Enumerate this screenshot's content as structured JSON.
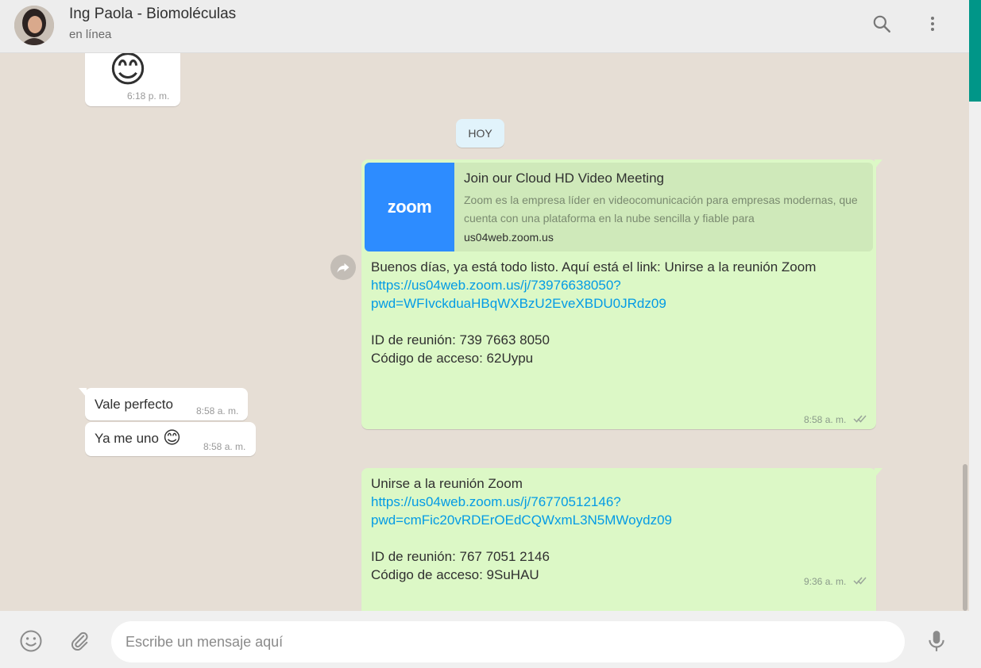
{
  "header": {
    "contact_name": "Ing Paola - Biomoléculas",
    "status": "en línea",
    "avatar_icon": "contact-avatar",
    "search_icon": "search-icon",
    "menu_icon": "more-vert-icon"
  },
  "chat": {
    "messages": [
      {
        "direction": "incoming",
        "content": "😊",
        "time": "6:18 p. m."
      },
      {
        "type": "date-divider",
        "label": "HOY"
      },
      {
        "direction": "outgoing",
        "link_preview": {
          "logo_text": "zoom",
          "title": "Join our Cloud HD Video Meeting",
          "description": "Zoom es la empresa líder en videocomunicación para empresas modernas, que cuenta con una plataforma en la nube sencilla y fiable para",
          "domain": "us04web.zoom.us"
        },
        "text_line1": "Buenos días, ya está todo listo. Aquí está el link: Unirse a la reunión Zoom",
        "link_line1": "https://us04web.zoom.us/j/73976638050?",
        "link_line2": "pwd=WFIvckduaHBqWXBzU2EveXBDU0JRdz09",
        "meeting_id": "ID de reunión: 739 7663 8050",
        "access_code": "Código de acceso: 62Uypu",
        "time": "8:58 a. m.",
        "status": "read"
      },
      {
        "direction": "incoming",
        "text": "Vale perfecto",
        "time": "8:58 a. m."
      },
      {
        "direction": "incoming",
        "text": "Ya me uno",
        "emoji": "😊",
        "time": "8:58 a. m."
      },
      {
        "direction": "outgoing",
        "text_line1": "Unirse a la reunión Zoom",
        "link_line1": "https://us04web.zoom.us/j/76770512146?",
        "link_line2": "pwd=cmFic20vRDErOEdCQWxmL3N5MWoydz09",
        "meeting_id": "ID de reunión: 767 7051 2146",
        "access_code": "Código de acceso: 9SuHAU",
        "time": "9:36 a. m.",
        "status": "read"
      }
    ]
  },
  "composer": {
    "placeholder": "Escribe un mensaje aquí",
    "emoji_icon": "emoji-icon",
    "attach_icon": "paperclip-icon",
    "mic_icon": "microphone-icon"
  },
  "colors": {
    "outgoing_bubble": "#dcf8c6",
    "incoming_bubble": "#ffffff",
    "link": "#039be5",
    "zoom_brand": "#2d8cff",
    "accent": "#009688",
    "read_ticks": "#4fc3f7"
  }
}
